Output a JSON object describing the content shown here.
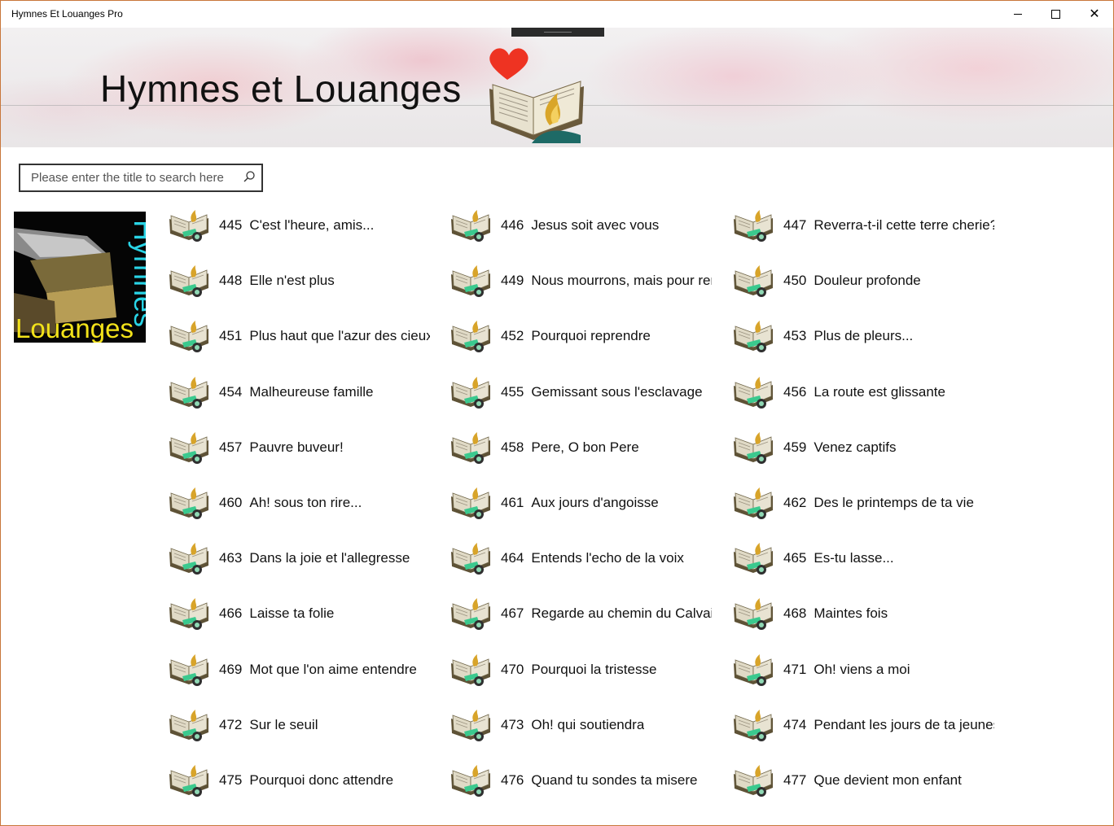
{
  "window": {
    "title": "Hymnes Et Louanges Pro",
    "minimize_glyph": "",
    "maximize_glyph": "",
    "close_glyph": "✕"
  },
  "header": {
    "title": "Hymnes et Louanges",
    "logo_icon": "heart-bible-icon"
  },
  "search": {
    "placeholder": "Please enter the title to search here",
    "value": ""
  },
  "cover": {
    "text_vertical": "Hymnes",
    "text_horizontal": "Louanges"
  },
  "colors": {
    "accent_heart": "#ee3322",
    "cover_cyan": "#29d4e6",
    "cover_yellow": "#f2e21a"
  },
  "hymns": [
    {
      "number": "445",
      "title": "C'est l'heure, amis..."
    },
    {
      "number": "446",
      "title": "Jesus soit avec vous"
    },
    {
      "number": "447",
      "title": "Reverra-t-il cette terre cherie?"
    },
    {
      "number": "448",
      "title": "Elle n'est plus"
    },
    {
      "number": "449",
      "title": "Nous mourrons, mais pour ren"
    },
    {
      "number": "450",
      "title": "Douleur profonde"
    },
    {
      "number": "451",
      "title": "Plus haut que l'azur des cieux"
    },
    {
      "number": "452",
      "title": "Pourquoi reprendre"
    },
    {
      "number": "453",
      "title": "Plus de pleurs..."
    },
    {
      "number": "454",
      "title": "Malheureuse famille"
    },
    {
      "number": "455",
      "title": "Gemissant sous l'esclavage"
    },
    {
      "number": "456",
      "title": "La route est glissante"
    },
    {
      "number": "457",
      "title": "Pauvre buveur!"
    },
    {
      "number": "458",
      "title": "Pere, O bon Pere"
    },
    {
      "number": "459",
      "title": "Venez captifs"
    },
    {
      "number": "460",
      "title": "Ah! sous ton rire..."
    },
    {
      "number": "461",
      "title": "Aux jours d'angoisse"
    },
    {
      "number": "462",
      "title": "Des le printemps de ta vie"
    },
    {
      "number": "463",
      "title": "Dans la joie et l'allegresse"
    },
    {
      "number": "464",
      "title": "Entends l'echo de la voix"
    },
    {
      "number": "465",
      "title": "Es-tu lasse..."
    },
    {
      "number": "466",
      "title": "Laisse ta folie"
    },
    {
      "number": "467",
      "title": "Regarde au chemin du Calvaire"
    },
    {
      "number": "468",
      "title": "Maintes fois"
    },
    {
      "number": "469",
      "title": "Mot que l'on aime entendre"
    },
    {
      "number": "470",
      "title": "Pourquoi la tristesse"
    },
    {
      "number": "471",
      "title": "Oh! viens a moi"
    },
    {
      "number": "472",
      "title": "Sur le seuil"
    },
    {
      "number": "473",
      "title": "Oh! qui soutiendra"
    },
    {
      "number": "474",
      "title": "Pendant les jours de ta jeunesse"
    },
    {
      "number": "475",
      "title": "Pourquoi donc attendre"
    },
    {
      "number": "476",
      "title": "Quand tu sondes ta misere"
    },
    {
      "number": "477",
      "title": "Que devient mon enfant"
    }
  ]
}
